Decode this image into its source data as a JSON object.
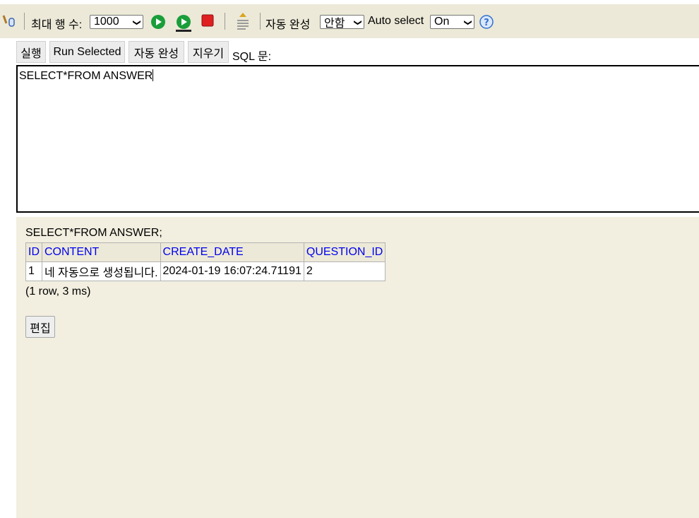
{
  "toolbar": {
    "max_rows_label": "최대 행 수:",
    "max_rows_value": "1000",
    "auto_complete_label": "자동 완성",
    "auto_complete_value": "안함",
    "auto_select_label": "Auto select",
    "auto_select_value": "On",
    "help_glyph": "?"
  },
  "buttons": {
    "run": "실행",
    "run_selected": "Run Selected",
    "auto_complete": "자동 완성",
    "clear": "지우기",
    "sql_label": "SQL 문:"
  },
  "editor": {
    "text": "SELECT*FROM ANSWER"
  },
  "result": {
    "query": "SELECT*FROM ANSWER;",
    "columns": [
      "ID",
      "CONTENT",
      "CREATE_DATE",
      "QUESTION_ID"
    ],
    "rows": [
      [
        "1",
        "네 자동으로 생성됩니다.",
        "2024-01-19 16:07:24.71191",
        "2"
      ]
    ],
    "summary": "(1 row, 3 ms)",
    "edit_button": "편집"
  },
  "colors": {
    "toolbar_bg": "#ece9d8",
    "result_bg": "#f2efe0",
    "header_text": "#0000ee",
    "run_green": "#1a9e3a",
    "stop_red": "#e02020",
    "help_blue": "#2f6fd0"
  }
}
